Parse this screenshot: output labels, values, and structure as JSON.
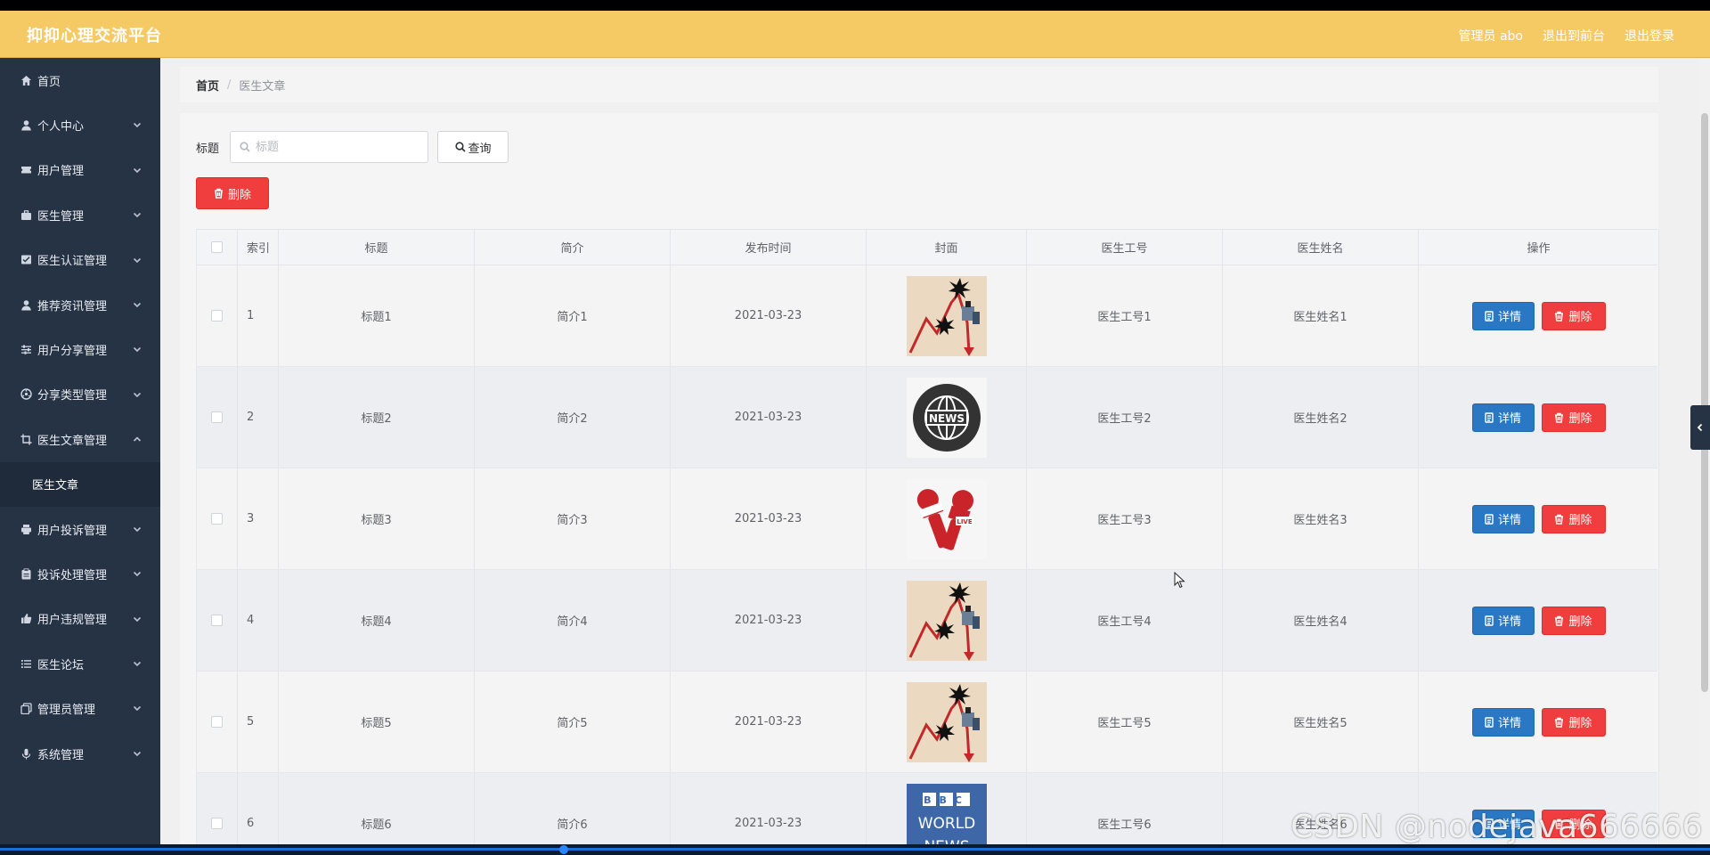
{
  "header": {
    "brand": "抑抑心理交流平台",
    "nav": [
      "管理员 abo",
      "退出到前台",
      "退出登录"
    ]
  },
  "sidebar": {
    "items": [
      {
        "label": "首页",
        "icon": "home-icon",
        "has_children": false
      },
      {
        "label": "个人中心",
        "icon": "user-icon",
        "has_children": true
      },
      {
        "label": "用户管理",
        "icon": "ticket-icon",
        "has_children": true
      },
      {
        "label": "医生管理",
        "icon": "briefcase-icon",
        "has_children": true
      },
      {
        "label": "医生认证管理",
        "icon": "checklist-icon",
        "has_children": true
      },
      {
        "label": "推荐资讯管理",
        "icon": "user-icon",
        "has_children": true
      },
      {
        "label": "用户分享管理",
        "icon": "sliders-icon",
        "has_children": true
      },
      {
        "label": "分享类型管理",
        "icon": "dial-icon",
        "has_children": true
      },
      {
        "label": "医生文章管理",
        "icon": "crop-icon",
        "has_children": true,
        "expanded": true
      },
      {
        "label": "用户投诉管理",
        "icon": "printer-icon",
        "has_children": true
      },
      {
        "label": "投诉处理管理",
        "icon": "clipboard-icon",
        "has_children": true
      },
      {
        "label": "用户违规管理",
        "icon": "thumb-icon",
        "has_children": true
      },
      {
        "label": "医生论坛",
        "icon": "list-icon",
        "has_children": true
      },
      {
        "label": "管理员管理",
        "icon": "copy-icon",
        "has_children": true
      },
      {
        "label": "系统管理",
        "icon": "mic-icon",
        "has_children": true
      }
    ],
    "sub_item": "医生文章"
  },
  "breadcrumb": {
    "home": "首页",
    "separator": "/",
    "current": "医生文章"
  },
  "search": {
    "label": "标题",
    "placeholder": "标题",
    "value": "",
    "query_label": "查询"
  },
  "toolbar": {
    "delete_label": "删除"
  },
  "table": {
    "columns": [
      "",
      "索引",
      "标题",
      "简介",
      "发布时间",
      "封面",
      "医生工号",
      "医生姓名",
      "操作"
    ],
    "detail_label": "详情",
    "delete_label": "删除",
    "rows": [
      {
        "index": "1",
        "title": "标题1",
        "intro": "简介1",
        "date": "2021-03-23",
        "cover": "chart-crash",
        "no": "医生工号1",
        "name": "医生姓名1"
      },
      {
        "index": "2",
        "title": "标题2",
        "intro": "简介2",
        "date": "2021-03-23",
        "cover": "news-globe",
        "no": "医生工号2",
        "name": "医生姓名2"
      },
      {
        "index": "3",
        "title": "标题3",
        "intro": "简介3",
        "date": "2021-03-23",
        "cover": "microphones",
        "no": "医生工号3",
        "name": "医生姓名3"
      },
      {
        "index": "4",
        "title": "标题4",
        "intro": "简介4",
        "date": "2021-03-23",
        "cover": "chart-crash",
        "no": "医生工号4",
        "name": "医生姓名4"
      },
      {
        "index": "5",
        "title": "标题5",
        "intro": "简介5",
        "date": "2021-03-23",
        "cover": "chart-crash",
        "no": "医生工号5",
        "name": "医生姓名5"
      },
      {
        "index": "6",
        "title": "标题6",
        "intro": "简介6",
        "date": "2021-03-23",
        "cover": "bbc-world-news",
        "no": "医生工号6",
        "name": "医生姓名6"
      }
    ]
  },
  "cover_text": {
    "news": "NEWS",
    "live": "LIVE",
    "bbc": "BBC",
    "world": "WORLD",
    "news2": "NEWS"
  },
  "watermark": "CSDN @nodejava666666",
  "colors": {
    "header": "#f5c964",
    "sidebar": "#263345",
    "primary": "#2a78c4",
    "danger": "#f03e3e"
  }
}
